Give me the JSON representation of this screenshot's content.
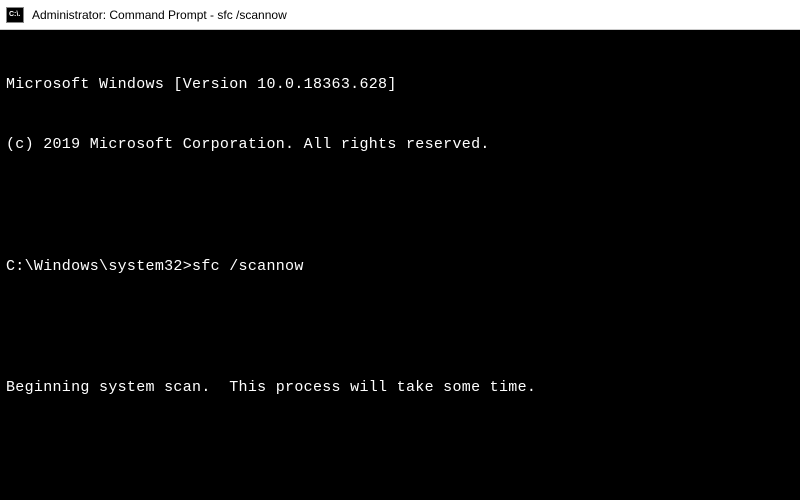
{
  "titlebar": {
    "icon_label": "C:\\.",
    "title": "Administrator: Command Prompt - sfc  /scannow"
  },
  "terminal": {
    "version_line": "Microsoft Windows [Version 10.0.18363.628]",
    "copyright_line": "(c) 2019 Microsoft Corporation. All rights reserved.",
    "prompt_path": "C:\\Windows\\system32>",
    "prompt_command": "sfc /scannow",
    "status_line": "Beginning system scan.  This process will take some time."
  }
}
